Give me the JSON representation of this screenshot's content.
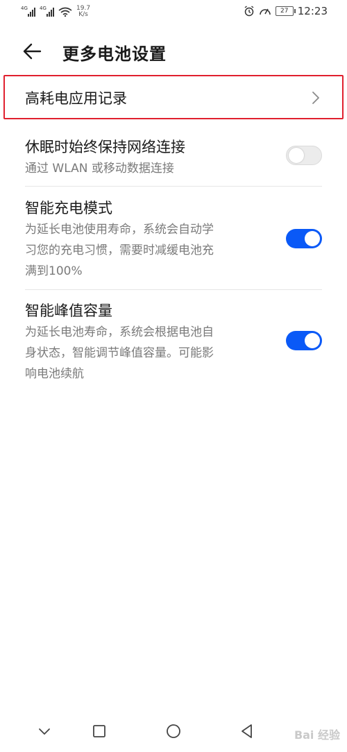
{
  "status_bar": {
    "signal_1_tag": "4G",
    "signal_2_tag": "4G",
    "net_speed_value": "19.7",
    "net_speed_unit": "K/s",
    "battery": "27",
    "time": "12:23",
    "icons": [
      "signal-icon",
      "signal-icon",
      "wifi-icon",
      "alarm-icon",
      "speedometer-icon",
      "battery-icon"
    ]
  },
  "header": {
    "title": "更多电池设置"
  },
  "items": [
    {
      "title": "高耗电应用记录"
    },
    {
      "title": "休眠时始终保持网络连接",
      "desc": "通过 WLAN 或移动数据连接",
      "enabled": false
    },
    {
      "title": "智能充电模式",
      "desc_lines": [
        "为延长电池使用寿命，系统会自动学",
        "习您的充电习惯，需要时减缓电池充",
        "满到100%"
      ],
      "enabled": true
    },
    {
      "title": "智能峰值容量",
      "desc_lines": [
        "为延长电池寿命，系统会根据电池自",
        "身状态，智能调节峰值容量。可能影",
        "响电池续航"
      ],
      "enabled": true
    }
  ],
  "colors": {
    "accent": "#0a59f7",
    "highlight": "#e0202e"
  },
  "watermark": "Bai 经验"
}
